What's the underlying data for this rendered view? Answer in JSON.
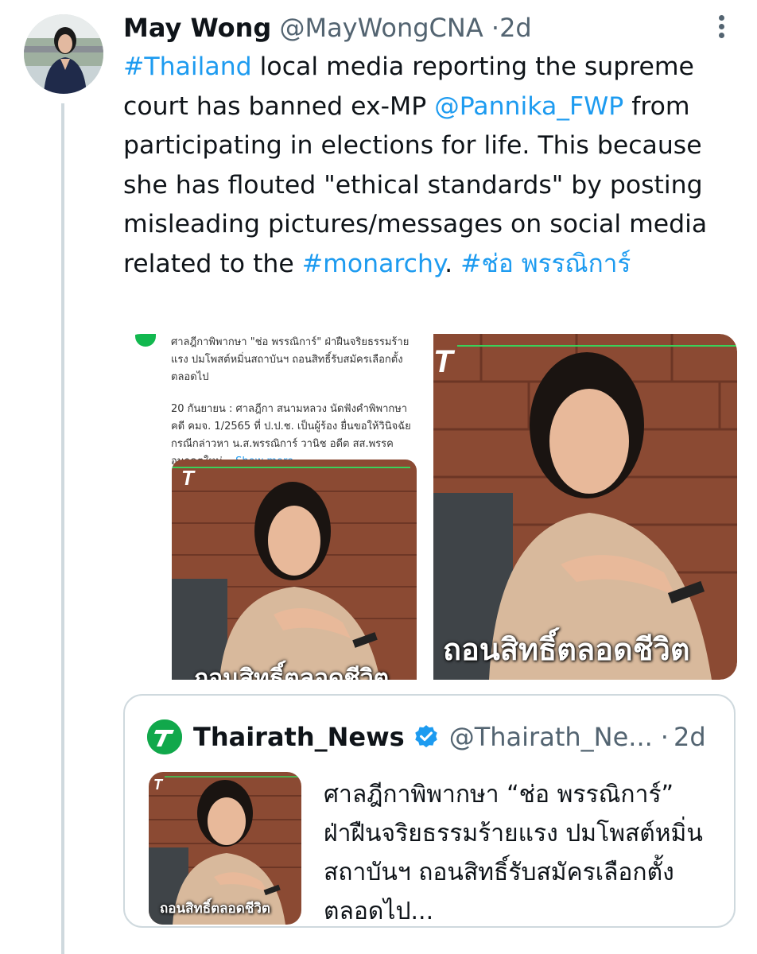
{
  "tweet": {
    "author_name": "May Wong",
    "handle": "@MayWongCNA",
    "separator": "·",
    "time": "2d",
    "text_parts": [
      {
        "t": "#Thailand",
        "link": true
      },
      {
        "t": " local media reporting the supreme court has banned ex-MP ",
        "link": false
      },
      {
        "t": "@Pannika_FWP",
        "link": true
      },
      {
        "t": " from participating in elections for life. This because she has flouted \"ethical standards\" by posting misleading pictures/messages on social media related to the ",
        "link": false
      },
      {
        "t": "#monarchy",
        "link": true
      },
      {
        "t": ". ",
        "link": false
      },
      {
        "t": "#ช่อ พรรณิการ์",
        "link": true
      }
    ]
  },
  "media_left": {
    "headline": "ศาลฎีกาพิพากษา \"ช่อ พรรณิการ์\" ฝ่าฝืนจริยธรรมร้ายแรง ปมโพสต์หมิ่นสถาบันฯ ถอนสิทธิ์รับสมัครเลือกตั้งตลอดไป",
    "body": "20 กันยายน : ศาลฎีกา สนามหลวง นัดฟังคำพิพากษา คดี คมจ. 1/2565 ที่ ป.ป.ช. เป็นผู้ร้อง ยื่นขอให้วินิจฉัย กรณีกล่าวหา น.ส.พรรณิการ์ วานิช อดีต สส.พรรคอนาคตใหม่...",
    "show_more": "Show more",
    "caption": "ถอนสิทธิ์ตลอดชีวิต"
  },
  "media_right": {
    "caption": "ถอนสิทธิ์ตลอดชีวิต"
  },
  "quote": {
    "author_name": "Thairath_News",
    "handle": "@Thairath_Ne...",
    "separator": "·",
    "time": "2d",
    "text": "ศาลฎีกาพิพากษา “ช่อ พรรณิการ์” ฝ่าฝืนจริยธรรมร้ายแรง ปมโพสต์หมิ่นสถาบันฯ ถอนสิทธิ์รับสมัครเลือกตั้งตลอดไป...",
    "caption": "ถอนสิทธิ์ตลอดชีวิต"
  },
  "colors": {
    "link": "#1d9bf0",
    "muted": "#536471",
    "verified": "#1d9bf0",
    "thairath_green": "#11a84b",
    "brick": "#8b4a33"
  },
  "icons": {
    "more": "more-vertical-icon",
    "verified": "verified-badge-icon",
    "logo": "thairath-logo-icon"
  }
}
